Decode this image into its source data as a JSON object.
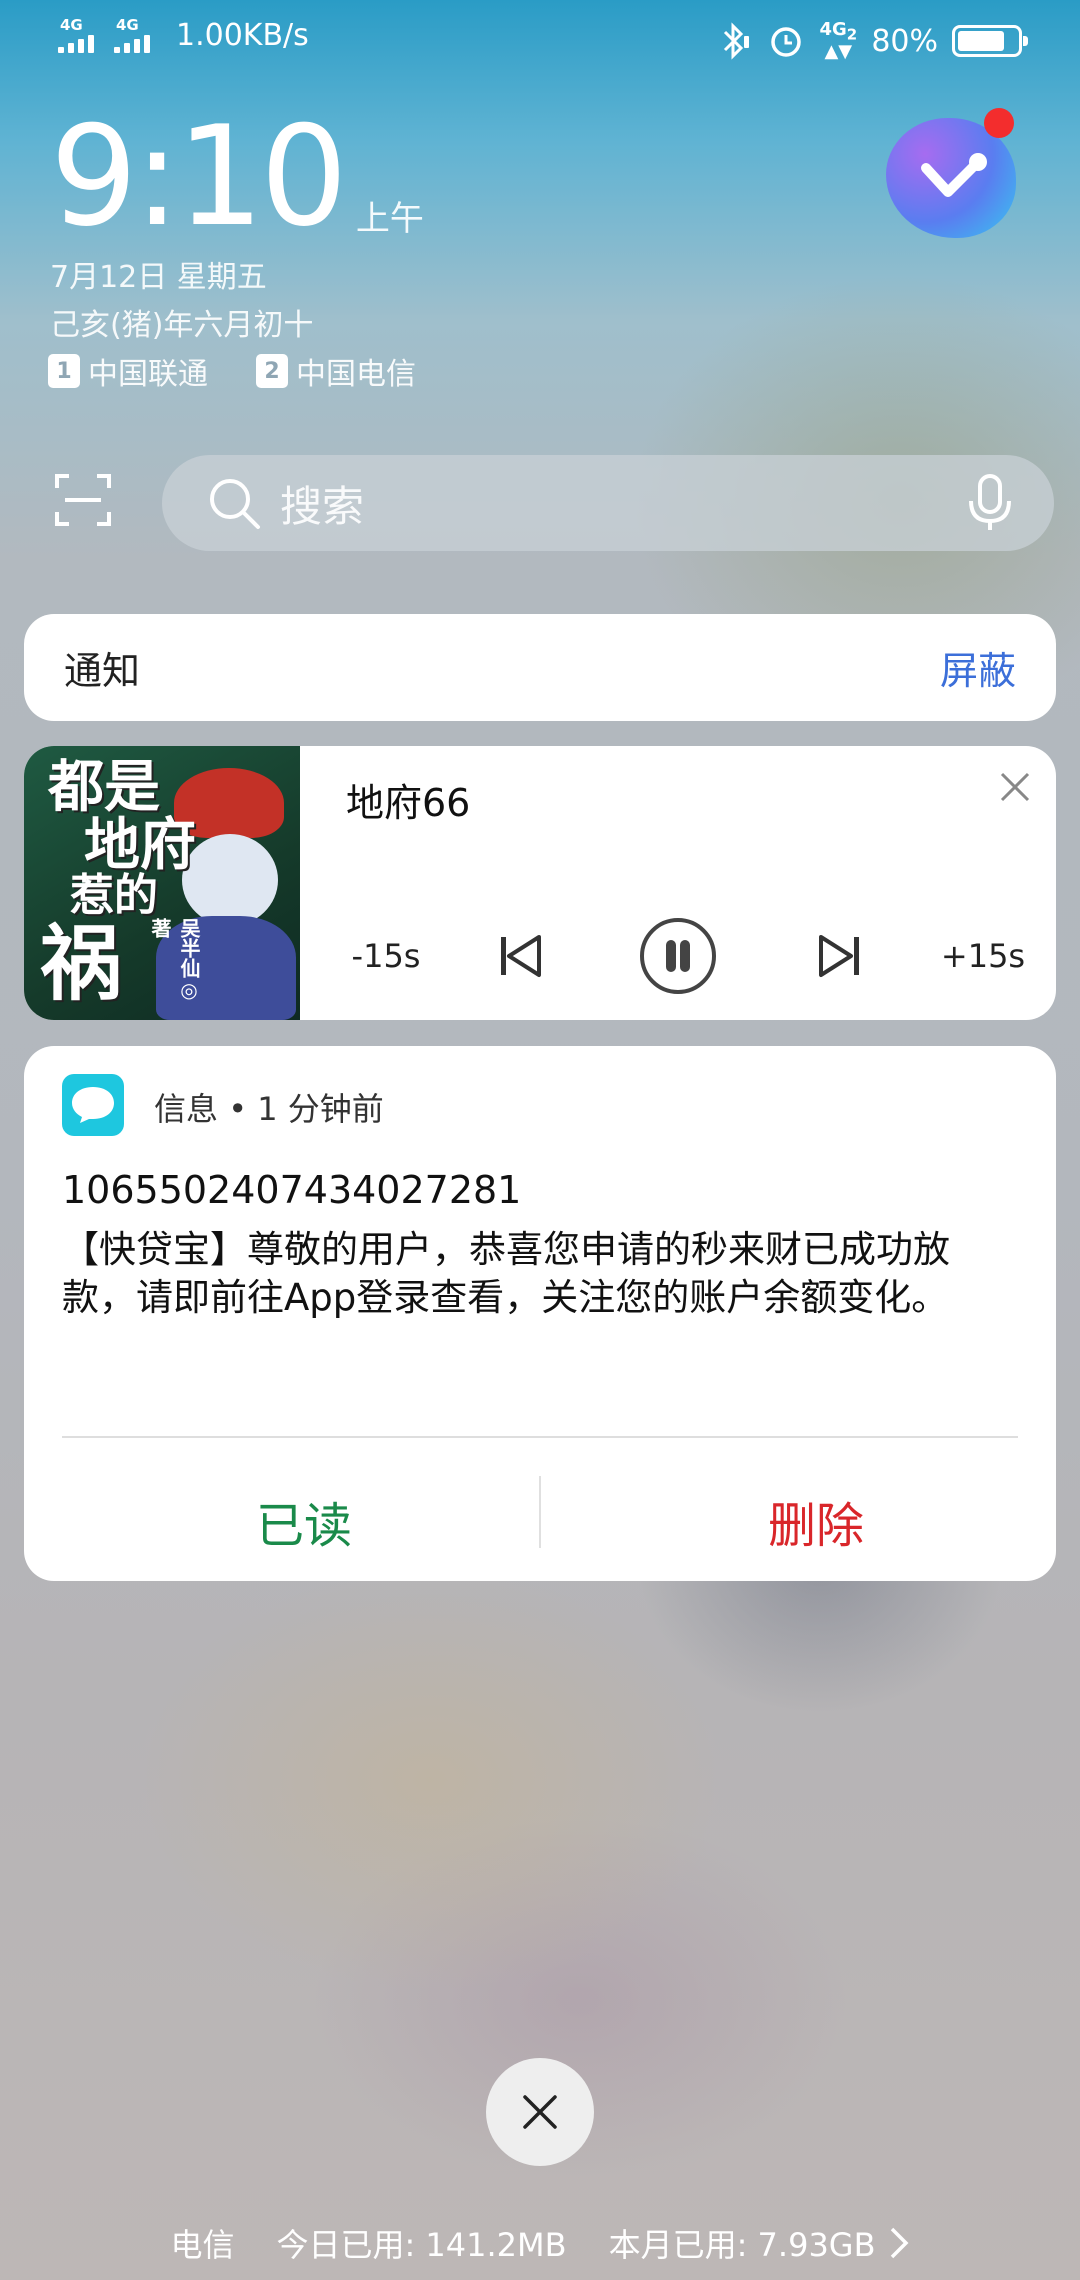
{
  "status_bar": {
    "sim1_network": "4G",
    "sim2_network": "4G",
    "net_speed": "1.00KB/s",
    "icons": [
      "bluetooth-icon",
      "alarm-icon",
      "4g2-icon",
      "battery-icon"
    ],
    "net4g2": "4G",
    "net4g2_sub": "2",
    "battery_percent": "80%",
    "battery_level": 0.8
  },
  "clock": {
    "time": "9:10",
    "ampm": "上午",
    "date": "7月12日 星期五",
    "lunar": "己亥(猪)年六月初十"
  },
  "carriers": [
    {
      "slot": "1",
      "name": "中国联通"
    },
    {
      "slot": "2",
      "name": "中国电信"
    }
  ],
  "search": {
    "placeholder": "搜索"
  },
  "notice_card": {
    "title": "通知",
    "block_label": "屏蔽"
  },
  "media": {
    "cover_title": "都是地府惹的祸",
    "cover_author": "吴半仙◎著",
    "track_title": "地府66",
    "rewind_label": "-15s",
    "forward_label": "+15s",
    "state": "playing"
  },
  "message": {
    "app_name": "信息",
    "time_ago": "1 分钟前",
    "sender": "1065502407434027281",
    "body": "【快贷宝】尊敬的用户，恭喜您申请的秒来财已成功放款，请即前往App登录查看，关注您的账户余额变化。",
    "read_label": "已读",
    "delete_label": "删除"
  },
  "data_usage": {
    "carrier": "电信",
    "today": "今日已用: 141.2MB",
    "month": "本月已用: 7.93GB"
  },
  "colors": {
    "accent_blue": "#3c6fd9",
    "read_green": "#1a8a4a",
    "delete_red": "#d9262a",
    "message_app": "#1ec7df",
    "notification_dot": "#f32d2d"
  }
}
